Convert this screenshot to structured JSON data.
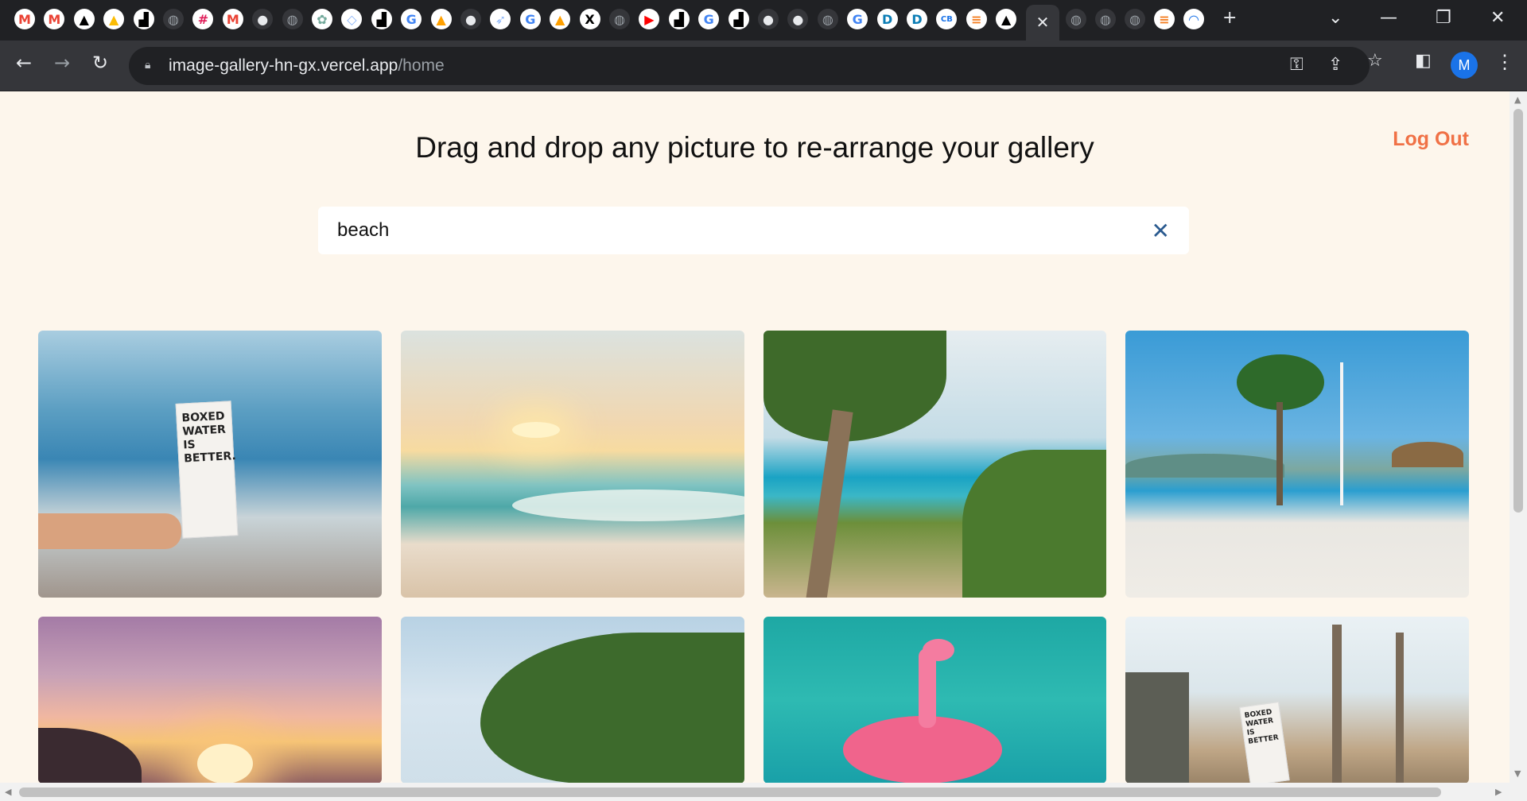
{
  "browser": {
    "tabs": [
      {
        "icon": "gmail-icon",
        "glyph": "M",
        "color": "#ea4335"
      },
      {
        "icon": "gmail-icon",
        "glyph": "M",
        "color": "#ea4335"
      },
      {
        "icon": "vercel-icon",
        "glyph": "▲",
        "color": "#000000"
      },
      {
        "icon": "drive-icon",
        "glyph": "▲",
        "color": "#fbbc04"
      },
      {
        "icon": "dark-site-icon",
        "glyph": "▟",
        "color": "#000000"
      },
      {
        "icon": "globe-icon",
        "glyph": "◍",
        "color": "#9aa0a6"
      },
      {
        "icon": "slack-icon",
        "glyph": "#",
        "color": "#e01e5a"
      },
      {
        "icon": "gmail-icon",
        "glyph": "M",
        "color": "#ea4335"
      },
      {
        "icon": "github-icon",
        "glyph": "●",
        "color": "#e8eaed"
      },
      {
        "icon": "globe-icon",
        "glyph": "◍",
        "color": "#9aa0a6"
      },
      {
        "icon": "chatgpt-icon",
        "glyph": "✿",
        "color": "#74aa9c"
      },
      {
        "icon": "code-icon",
        "glyph": "◇",
        "color": "#8ab4f8"
      },
      {
        "icon": "dark-site-icon",
        "glyph": "▟",
        "color": "#000000"
      },
      {
        "icon": "google-icon",
        "glyph": "G",
        "color": "#4285f4"
      },
      {
        "icon": "firebase-icon",
        "glyph": "▲",
        "color": "#ffa000"
      },
      {
        "icon": "github-icon",
        "glyph": "●",
        "color": "#e8eaed"
      },
      {
        "icon": "rocket-icon",
        "glyph": "➶",
        "color": "#8ab4f8"
      },
      {
        "icon": "google-icon",
        "glyph": "G",
        "color": "#4285f4"
      },
      {
        "icon": "firebase-icon",
        "glyph": "▲",
        "color": "#ffa000"
      },
      {
        "icon": "x-icon",
        "glyph": "X",
        "color": "#000000"
      },
      {
        "icon": "globe-icon",
        "glyph": "◍",
        "color": "#9aa0a6"
      },
      {
        "icon": "youtube-icon",
        "glyph": "▶",
        "color": "#ff0000"
      },
      {
        "icon": "dark-site-icon",
        "glyph": "▟",
        "color": "#000000"
      },
      {
        "icon": "google-icon",
        "glyph": "G",
        "color": "#4285f4"
      },
      {
        "icon": "dark-site-icon",
        "glyph": "▟",
        "color": "#000000"
      },
      {
        "icon": "github-icon",
        "glyph": "●",
        "color": "#e8eaed"
      },
      {
        "icon": "github-icon",
        "glyph": "●",
        "color": "#e8eaed"
      },
      {
        "icon": "globe-icon",
        "glyph": "◍",
        "color": "#9aa0a6"
      },
      {
        "icon": "google-icon",
        "glyph": "G",
        "color": "#4285f4"
      },
      {
        "icon": "d-icon",
        "glyph": "D",
        "color": "#0b7db5"
      },
      {
        "icon": "d-icon",
        "glyph": "D",
        "color": "#0b7db5"
      },
      {
        "icon": "cb-icon",
        "glyph": "CB",
        "color": "#1a73e8"
      },
      {
        "icon": "stackoverflow-icon",
        "glyph": "≡",
        "color": "#f48024"
      },
      {
        "icon": "vercel-icon",
        "glyph": "▲",
        "color": "#000000"
      }
    ],
    "active_tab_close": "✕",
    "tabs_after": [
      {
        "icon": "globe-icon",
        "glyph": "◍",
        "color": "#9aa0a6"
      },
      {
        "icon": "globe-icon",
        "glyph": "◍",
        "color": "#9aa0a6"
      },
      {
        "icon": "globe-icon",
        "glyph": "◍",
        "color": "#9aa0a6"
      },
      {
        "icon": "stackoverflow-icon",
        "glyph": "≡",
        "color": "#f48024"
      },
      {
        "icon": "spinner-icon",
        "glyph": "◠",
        "color": "#1a73e8"
      }
    ],
    "new_tab": "+",
    "window_controls": {
      "list": "⌄",
      "minimize": "—",
      "restore": "❐",
      "close": "✕"
    },
    "nav": {
      "back": "←",
      "forward": "→",
      "reload": "↻"
    },
    "address": {
      "host": "image-gallery-hn-gx.vercel.app",
      "path": "/home"
    },
    "toolbar_icons": {
      "key": "⚿",
      "share": "⇪",
      "star": "☆",
      "sidepanel": "◧"
    },
    "profile_initial": "M",
    "menu": "⋮"
  },
  "page": {
    "headline": "Drag and drop any picture to re-arrange your gallery",
    "logout_label": "Log Out",
    "search": {
      "value": "beach",
      "clear_glyph": "✕"
    },
    "gallery": [
      {
        "name": "gallery-image-boxed-water-beach",
        "carton_text": "BOXED WATER IS BETTER."
      },
      {
        "name": "gallery-image-beach-sunset-waves"
      },
      {
        "name": "gallery-image-palm-trees-lagoon"
      },
      {
        "name": "gallery-image-beach-palm-umbrella"
      },
      {
        "name": "gallery-image-pink-sunset-island"
      },
      {
        "name": "gallery-image-palm-sky"
      },
      {
        "name": "gallery-image-flamingo-float"
      },
      {
        "name": "gallery-image-palm-beach-boxed-water",
        "carton_text": "BOXED WATER IS BETTER"
      }
    ]
  },
  "scrollbars": {
    "up": "▲",
    "down": "▼",
    "left": "◀",
    "right": "▶"
  }
}
